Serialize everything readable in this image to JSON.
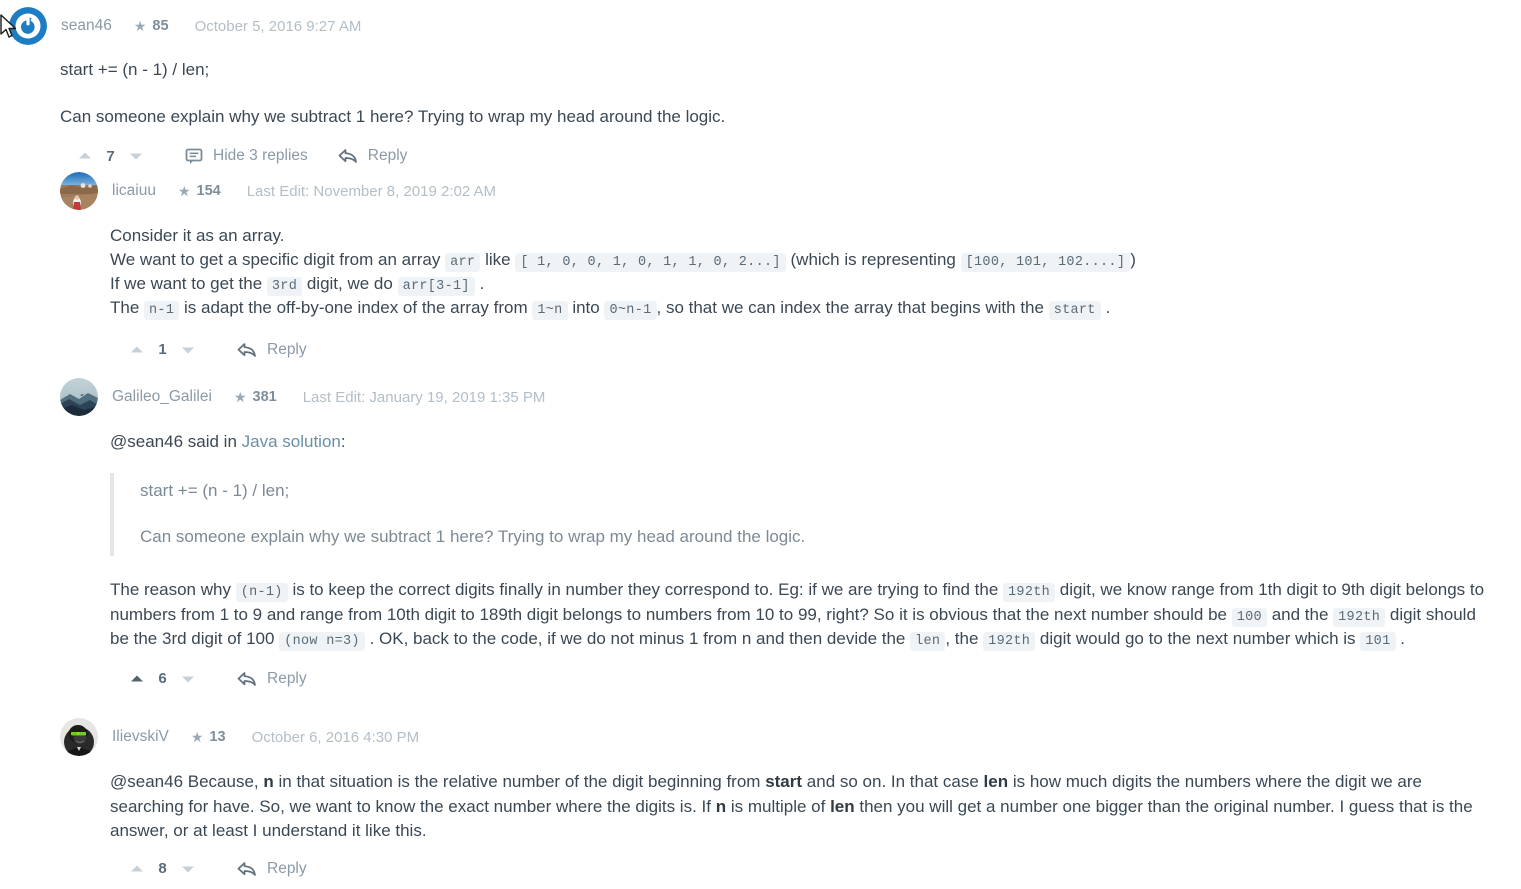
{
  "posts": [
    {
      "id": "sean46",
      "avatar": "nodebb-logo-avatar",
      "username": "sean46",
      "reputation": "85",
      "timestamp": "October 5, 2016 9:27 AM",
      "line1": "start += (n - 1) / len;",
      "line2": "Can someone explain why we subtract 1 here? Trying to wrap my head around the logic.",
      "votes": "7",
      "hide_replies_label": "Hide 3 replies",
      "reply_label": "Reply"
    },
    {
      "id": "licaiuu",
      "avatar": "desert-photo-avatar",
      "username": "licaiuu",
      "reputation": "154",
      "timestamp": "Last Edit: November 8, 2019 2:02 AM",
      "l1": "Consider it as an array.",
      "l2a": "We want to get a specific digit from an array",
      "l2code1": "arr",
      "l2b": "like",
      "l2code2": "[ 1, 0, 0, 1, 0, 1, 1, 0, 2...]",
      "l2c": "(which is representing",
      "l2code3": "[100, 101, 102....]",
      "l2d": ")",
      "l3a": "If we want to get the",
      "l3code1": "3rd",
      "l3b": "digit, we do",
      "l3code2": "arr[3-1]",
      "l3c": ".",
      "l4a": "The",
      "l4code1": "n-1",
      "l4b": "is adapt the off-by-one index of the array from",
      "l4code2": "1~n",
      "l4c": "into",
      "l4code3": "0~n-1",
      "l4d": ", so that we can index the array that begins with the",
      "l4code4": "start",
      "l4e": ".",
      "votes": "1",
      "reply_label": "Reply"
    },
    {
      "id": "galileo",
      "avatar": "mountain-photo-avatar",
      "username": "Galileo_Galilei",
      "reputation": "381",
      "timestamp": "Last Edit: January 19, 2019 1:35 PM",
      "quote_intro_a": "@sean46 said in",
      "quote_intro_link": "Java solution",
      "quote_intro_b": ":",
      "quote_line1": "start += (n - 1) / len;",
      "quote_line2": "Can someone explain why we subtract 1 here? Trying to wrap my head around the logic.",
      "p_a": "The reason why",
      "p_code1": "(n-1)",
      "p_b": "is to keep the correct digits finally in number they correspond to. Eg: if we are trying to find the",
      "p_code2": "192th",
      "p_c": "digit, we know range from 1th digit to 9th digit belongs to numbers from 1 to 9 and range from 10th digit to 189th digit belongs to numbers from 10 to 99, right? So it is obvious that the next number should be",
      "p_code3": "100",
      "p_d": "and the",
      "p_code4": "192th",
      "p_e": "digit should be the 3rd digit of 100",
      "p_code5": "(now n=3)",
      "p_f": ". OK, back to the code, if we do not minus 1 from n and then devide the",
      "p_code6": "len",
      "p_g": ", the",
      "p_code7": "192th",
      "p_h": "digit would go to the next number which is",
      "p_code8": "101",
      "p_i": ".",
      "votes": "6",
      "voted": "up",
      "reply_label": "Reply"
    },
    {
      "id": "ilievskiv",
      "avatar": "gorilla-photo-avatar",
      "username": "IlievskiV",
      "reputation": "13",
      "timestamp": "October 6, 2016 4:30 PM",
      "p_a": "@sean46 Because,",
      "p_b1": "n",
      "p_c": "in that situation is the relative number of the digit beginning from",
      "p_b2": "start",
      "p_d": "and so on. In that case",
      "p_b3": "len",
      "p_e": "is how much digits the numbers where the digit we are searching for have. So, we want to know the exact number where the digits is. If",
      "p_b4": "n",
      "p_f": "is multiple of",
      "p_b5": "len",
      "p_g": "then you will get a number one bigger than the original number. I guess that is the answer, or at least I understand it like this.",
      "votes": "8",
      "reply_label": "Reply"
    }
  ],
  "icons": {
    "star": "★",
    "upvote": "caret-up-icon",
    "downvote": "caret-down-icon",
    "replies": "comment-bubble-icon",
    "reply": "reply-arrow-icon"
  },
  "colors": {
    "link": "#6a8fa8",
    "muted": "#8b9aa6",
    "code_bg": "#f0f3f5",
    "quote_border": "#e3e7ea",
    "accent": "#1d7dc4"
  }
}
